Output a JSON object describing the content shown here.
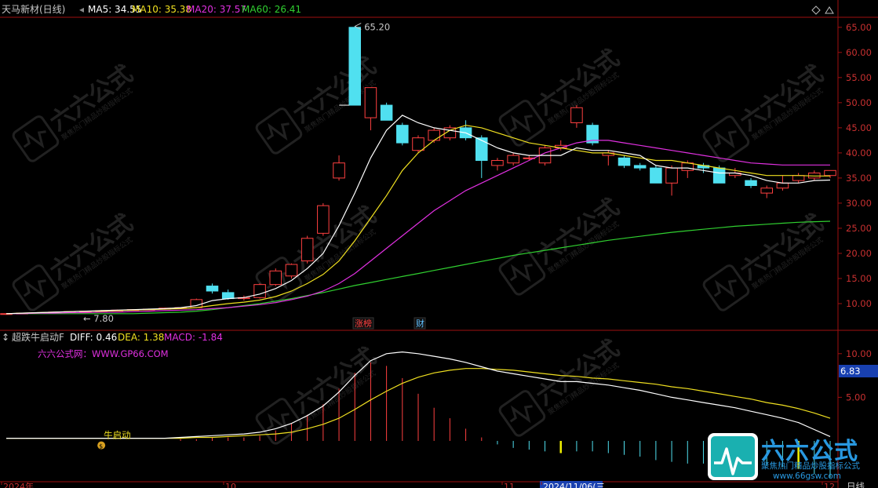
{
  "header": {
    "stock": "天马新材(日线)",
    "ma": [
      {
        "label": "MA5: 34.55",
        "color": "#ffffff"
      },
      {
        "label": "MA10: 35.38",
        "color": "#f0e020"
      },
      {
        "label": "MA20: 37.57",
        "color": "#e030e0"
      },
      {
        "label": "MA60: 26.41",
        "color": "#30d030"
      }
    ]
  },
  "price_axis": {
    "ticks": [
      "65.00",
      "60.00",
      "55.00",
      "50.00",
      "45.00",
      "40.00",
      "35.00",
      "30.00",
      "25.00",
      "20.00",
      "15.00",
      "10.00"
    ],
    "tick_values": [
      65,
      60,
      55,
      50,
      45,
      40,
      35,
      30,
      25,
      20,
      15,
      10
    ],
    "min": 5,
    "max": 67
  },
  "price_annotations": {
    "high": "65.20",
    "low": "7.80"
  },
  "event_markers": [
    {
      "label": "涨榜",
      "color": "#ff4040"
    },
    {
      "label": "财",
      "color": "#60c0ff"
    }
  ],
  "macd": {
    "title": "超跌牛启动F",
    "diff_label": "DIFF: 0.46",
    "dea_label": "DEA: 1.38",
    "macd_label": "MACD: -1.84",
    "site_label": "六六公式网：WWW.GP66.COM",
    "signal_label": "牛启动",
    "badge_value": "6.83",
    "ticks": [
      "10.00",
      "5.00"
    ],
    "tick_values": [
      10,
      5
    ]
  },
  "time_axis": {
    "labels": [
      "2024年",
      "10",
      "11",
      "2024/11/06(三",
      "12"
    ],
    "period": "日线"
  },
  "watermark": {
    "brand": "六六公式",
    "slogan": "聚焦热门精品炒股指标公式",
    "url": "www.66gsw.com"
  },
  "colors": {
    "up": "#ff4040",
    "down": "#50e0f0",
    "grid": "#a01010",
    "axis_text": "#c83030"
  },
  "chart_data": {
    "type": "candlestick",
    "candles": [
      [
        7.9,
        8.1,
        7.8,
        8.0
      ],
      [
        8.0,
        8.2,
        7.9,
        8.1
      ],
      [
        8.1,
        8.3,
        8.0,
        8.2
      ],
      [
        8.2,
        8.4,
        8.1,
        8.3
      ],
      [
        8.3,
        8.5,
        8.2,
        8.4
      ],
      [
        8.4,
        8.6,
        8.3,
        8.5
      ],
      [
        8.5,
        8.7,
        8.4,
        8.6
      ],
      [
        8.6,
        8.8,
        8.5,
        8.7
      ],
      [
        8.7,
        8.9,
        8.6,
        8.8
      ],
      [
        8.8,
        9.0,
        8.7,
        8.9
      ],
      [
        8.9,
        9.2,
        8.8,
        9.1
      ],
      [
        9.1,
        9.3,
        9.0,
        9.2
      ],
      [
        9.2,
        11.0,
        9.1,
        10.8
      ],
      [
        13.5,
        14.0,
        12.0,
        12.5
      ],
      [
        12.2,
        12.8,
        10.8,
        11.0
      ],
      [
        11.0,
        11.6,
        10.6,
        11.2
      ],
      [
        11.2,
        14.0,
        11.0,
        13.8
      ],
      [
        13.8,
        17.0,
        13.5,
        16.5
      ],
      [
        15.5,
        18.0,
        15.0,
        17.8
      ],
      [
        18.5,
        23.5,
        18.0,
        23.0
      ],
      [
        24.0,
        30.0,
        23.5,
        29.5
      ],
      [
        35.0,
        39.5,
        34.5,
        38.0
      ],
      [
        65.0,
        65.2,
        49.5,
        49.5
      ],
      [
        47.0,
        53.0,
        44.5,
        53.0
      ],
      [
        49.5,
        50.0,
        46.5,
        46.5
      ],
      [
        45.5,
        46.0,
        41.5,
        42.0
      ],
      [
        40.5,
        43.5,
        40.0,
        43.0
      ],
      [
        42.5,
        45.0,
        42.0,
        44.5
      ],
      [
        43.0,
        45.5,
        42.5,
        45.0
      ],
      [
        45.0,
        46.5,
        42.5,
        43.0
      ],
      [
        43.0,
        43.5,
        35.0,
        38.5
      ],
      [
        37.5,
        39.0,
        36.5,
        38.5
      ],
      [
        38.0,
        40.0,
        37.5,
        39.5
      ],
      [
        39.0,
        39.5,
        38.5,
        39.0
      ],
      [
        38.0,
        41.5,
        37.5,
        41.0
      ],
      [
        41.0,
        42.5,
        40.5,
        41.5
      ],
      [
        46.0,
        49.5,
        45.0,
        49.0
      ],
      [
        45.5,
        46.0,
        41.5,
        42.0
      ],
      [
        39.5,
        40.5,
        37.5,
        40.0
      ],
      [
        39.0,
        39.5,
        37.0,
        37.5
      ],
      [
        37.5,
        38.0,
        36.5,
        37.0
      ],
      [
        37.0,
        37.5,
        34.0,
        34.0
      ],
      [
        34.0,
        37.5,
        31.5,
        37.0
      ],
      [
        36.5,
        38.5,
        35.0,
        38.0
      ],
      [
        37.5,
        38.0,
        36.0,
        37.0
      ],
      [
        37.0,
        37.5,
        34.0,
        34.0
      ],
      [
        35.5,
        37.0,
        35.0,
        36.0
      ],
      [
        34.5,
        35.0,
        33.0,
        33.5
      ],
      [
        32.0,
        33.5,
        31.0,
        33.0
      ],
      [
        33.0,
        35.5,
        32.5,
        34.0
      ],
      [
        34.5,
        36.0,
        34.0,
        35.5
      ],
      [
        35.0,
        36.5,
        34.5,
        36.0
      ],
      [
        35.5,
        36.5,
        35.0,
        36.5
      ]
    ],
    "ma5": [
      8.0,
      8.1,
      8.2,
      8.3,
      8.4,
      8.5,
      8.6,
      8.7,
      8.8,
      8.9,
      9.0,
      9.2,
      9.6,
      10.6,
      11.0,
      11.2,
      11.9,
      13.0,
      14.6,
      17.0,
      20.0,
      25.5,
      32.0,
      39.0,
      44.5,
      47.5,
      46.0,
      45.0,
      44.5,
      44.0,
      42.5,
      41.0,
      40.0,
      39.5,
      39.5,
      39.5,
      41.0,
      40.5,
      40.5,
      40.0,
      39.5,
      37.5,
      37.0,
      37.0,
      36.5,
      36.0,
      36.0,
      35.5,
      34.5,
      34.0,
      34.0,
      34.5,
      34.6
    ],
    "ma10": [
      8.0,
      8.1,
      8.2,
      8.3,
      8.4,
      8.5,
      8.5,
      8.6,
      8.7,
      8.8,
      8.9,
      9.0,
      9.2,
      9.6,
      10.0,
      10.3,
      10.7,
      11.4,
      12.5,
      14.0,
      15.8,
      18.5,
      22.5,
      27.0,
      31.5,
      36.5,
      40.0,
      42.5,
      44.5,
      45.5,
      45.0,
      44.0,
      43.0,
      42.0,
      41.5,
      41.0,
      40.5,
      40.0,
      40.0,
      39.5,
      39.0,
      38.5,
      38.5,
      38.0,
      37.5,
      37.0,
      36.5,
      36.0,
      35.5,
      35.5,
      35.5,
      35.4,
      35.4
    ],
    "ma20": [
      8.0,
      8.0,
      8.1,
      8.1,
      8.2,
      8.2,
      8.3,
      8.3,
      8.4,
      8.5,
      8.6,
      8.7,
      8.8,
      9.0,
      9.2,
      9.5,
      9.8,
      10.2,
      10.8,
      11.5,
      12.5,
      14.0,
      16.0,
      18.5,
      21.0,
      23.5,
      26.0,
      28.5,
      30.5,
      32.5,
      34.0,
      35.5,
      37.0,
      38.5,
      40.0,
      41.0,
      42.0,
      42.5,
      42.5,
      42.0,
      41.5,
      41.0,
      40.5,
      40.0,
      39.5,
      39.0,
      38.5,
      38.0,
      37.8,
      37.6,
      37.6,
      37.6,
      37.6
    ],
    "ma60": [
      8.0,
      8.0,
      8.0,
      8.0,
      8.0,
      8.0,
      8.0,
      8.0,
      8.0,
      8.1,
      8.2,
      8.3,
      8.5,
      8.8,
      9.2,
      9.6,
      10.0,
      10.5,
      11.0,
      11.6,
      12.2,
      12.9,
      13.6,
      14.2,
      14.8,
      15.4,
      16.0,
      16.6,
      17.2,
      17.8,
      18.4,
      19.0,
      19.6,
      20.1,
      20.6,
      21.1,
      21.6,
      22.1,
      22.6,
      23.0,
      23.4,
      23.8,
      24.2,
      24.5,
      24.8,
      25.1,
      25.4,
      25.6,
      25.8,
      26.0,
      26.2,
      26.3,
      26.4
    ],
    "diff": [
      0.3,
      0.3,
      0.3,
      0.3,
      0.3,
      0.3,
      0.3,
      0.3,
      0.3,
      0.3,
      0.3,
      0.4,
      0.5,
      0.6,
      0.7,
      0.8,
      1.0,
      1.4,
      2.0,
      2.9,
      4.0,
      5.6,
      7.5,
      9.2,
      10.0,
      10.2,
      10.0,
      9.7,
      9.4,
      9.0,
      8.5,
      8.0,
      7.7,
      7.4,
      7.1,
      6.8,
      6.8,
      6.6,
      6.4,
      6.1,
      5.8,
      5.4,
      5.0,
      4.7,
      4.4,
      4.1,
      3.8,
      3.4,
      3.0,
      2.6,
      2.1,
      1.3,
      0.5
    ],
    "dea": [
      0.3,
      0.3,
      0.3,
      0.3,
      0.3,
      0.3,
      0.3,
      0.3,
      0.3,
      0.3,
      0.3,
      0.3,
      0.4,
      0.4,
      0.5,
      0.6,
      0.7,
      0.8,
      1.0,
      1.4,
      1.9,
      2.6,
      3.6,
      4.7,
      5.7,
      6.6,
      7.3,
      7.8,
      8.1,
      8.3,
      8.3,
      8.2,
      8.1,
      7.9,
      7.7,
      7.5,
      7.4,
      7.2,
      7.1,
      6.9,
      6.7,
      6.5,
      6.2,
      6.0,
      5.7,
      5.4,
      5.1,
      4.8,
      4.4,
      4.1,
      3.7,
      3.2,
      2.6
    ],
    "signal_index": 6
  }
}
